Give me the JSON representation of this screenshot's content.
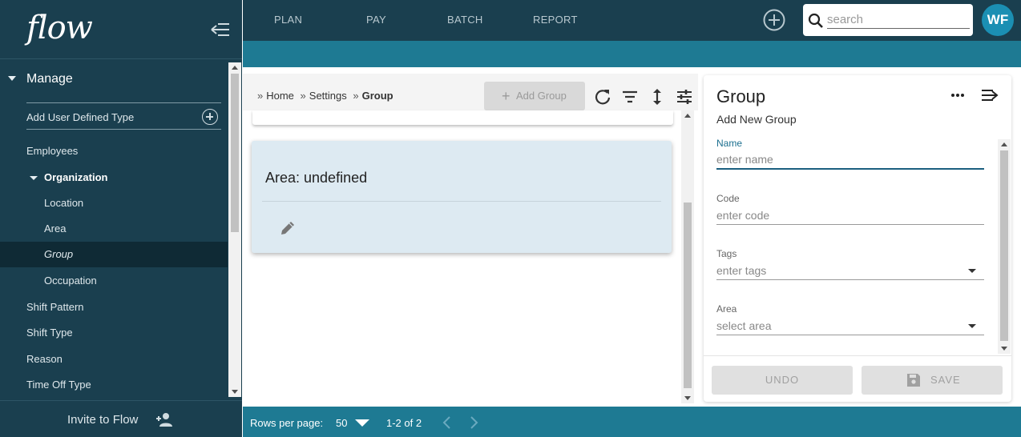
{
  "app": {
    "logo_text": "flow"
  },
  "sidebar": {
    "section_title": "Manage",
    "add_udt_label": "Add User Defined Type",
    "items": [
      {
        "label": "Employees",
        "level": 1
      },
      {
        "label": "Organization",
        "level": 1
      },
      {
        "label": "Location",
        "level": 2
      },
      {
        "label": "Area",
        "level": 2
      },
      {
        "label": "Group",
        "level": 2
      },
      {
        "label": "Occupation",
        "level": 2
      },
      {
        "label": "Shift Pattern",
        "level": 1
      },
      {
        "label": "Shift Type",
        "level": 1
      },
      {
        "label": "Reason",
        "level": 1
      },
      {
        "label": "Time Off Type",
        "level": 1
      }
    ],
    "invite_label": "Invite to Flow"
  },
  "topbar": {
    "tabs": [
      "PLAN",
      "PAY",
      "BATCH",
      "REPORT"
    ],
    "search_placeholder": "search",
    "avatar_initials": "WF"
  },
  "breadcrumb": {
    "home": "Home",
    "settings": "Settings",
    "current": "Group"
  },
  "toolbar": {
    "add_group_label": "Add Group"
  },
  "card": {
    "title": "Area: undefined"
  },
  "panel": {
    "title": "Group",
    "subtitle": "Add New Group",
    "fields": {
      "name": {
        "label": "Name",
        "placeholder": "enter name"
      },
      "code": {
        "label": "Code",
        "placeholder": "enter code"
      },
      "tags": {
        "label": "Tags",
        "placeholder": "enter tags"
      },
      "area": {
        "label": "Area",
        "placeholder": "select area"
      }
    },
    "undo_label": "UNDO",
    "save_label": "SAVE"
  },
  "footer": {
    "rows_per_page_label": "Rows per page:",
    "rows_per_page_value": "50",
    "range": "1-2 of 2"
  },
  "colors": {
    "sidebar_bg": "#1a3f4f",
    "accent_bar": "#1e7a93",
    "avatar": "#1b8fb3",
    "card_bg": "#ddeaf2"
  }
}
